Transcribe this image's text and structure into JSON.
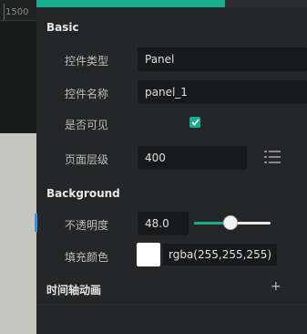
{
  "canvas": {
    "ruler_label": "1500"
  },
  "panel": {
    "basic_title": "Basic",
    "rows": [
      {
        "label": "控件类型",
        "value": "Panel"
      },
      {
        "label": "控件名称",
        "value": "panel_1"
      },
      {
        "label": "是否可见",
        "checked": true
      },
      {
        "label": "页面层级",
        "value": "400"
      }
    ],
    "background_title": "Background",
    "opacity": {
      "label": "不透明度",
      "value": "48.0",
      "level": 0.48
    },
    "fill": {
      "label": "填充颜色",
      "color": "#ffffff",
      "text": "rgba(255,255,255)"
    },
    "timeline_title": "时间轴动画",
    "icons": {
      "checkbox": "check-icon",
      "list": "list-icon",
      "add": "plus-icon"
    },
    "accent_color": "#19ad8e"
  }
}
